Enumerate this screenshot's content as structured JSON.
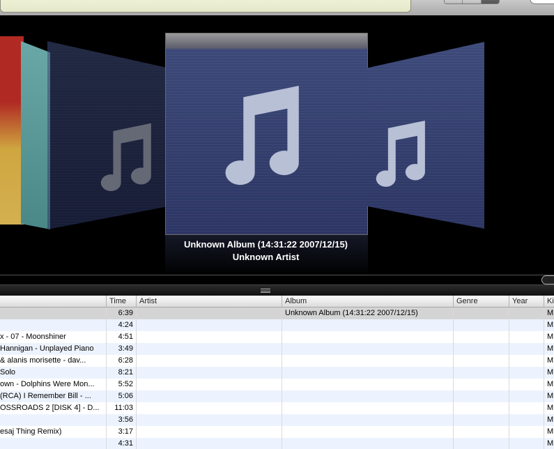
{
  "coverflow": {
    "now_showing": {
      "album": "Unknown Album (14:31:22 2007/12/15)",
      "artist": "Unknown Artist"
    }
  },
  "table": {
    "headers": {
      "time": "Time",
      "artist": "Artist",
      "album": "Album",
      "genre": "Genre",
      "year": "Year",
      "kind": "Ki"
    },
    "rows": [
      {
        "name": "",
        "time": "6:39",
        "artist": "",
        "album": "Unknown Album (14:31:22 2007/12/15)",
        "genre": "",
        "year": "",
        "kind": "M"
      },
      {
        "name": "",
        "time": "4:24",
        "artist": "",
        "album": "",
        "genre": "",
        "year": "",
        "kind": "M"
      },
      {
        "name": "x - 07 - Moonshiner",
        "time": "4:51",
        "artist": "",
        "album": "",
        "genre": "",
        "year": "",
        "kind": "M"
      },
      {
        "name": "Hannigan - Unplayed Piano",
        "time": "3:49",
        "artist": "",
        "album": "",
        "genre": "",
        "year": "",
        "kind": "M"
      },
      {
        "name": "& alanis morisette - dav...",
        "time": "6:28",
        "artist": "",
        "album": "",
        "genre": "",
        "year": "",
        "kind": "M"
      },
      {
        "name": "Solo",
        "time": "8:21",
        "artist": "",
        "album": "",
        "genre": "",
        "year": "",
        "kind": "M"
      },
      {
        "name": "own - Dolphins Were Mon...",
        "time": "5:52",
        "artist": "",
        "album": "",
        "genre": "",
        "year": "",
        "kind": "M"
      },
      {
        "name": "(RCA) I Remember Bill - ...",
        "time": "5:06",
        "artist": "",
        "album": "",
        "genre": "",
        "year": "",
        "kind": "M"
      },
      {
        "name": "OSSROADS 2 [DISK 4] - D...",
        "time": "11:03",
        "artist": "",
        "album": "",
        "genre": "",
        "year": "",
        "kind": "M"
      },
      {
        "name": "",
        "time": "3:56",
        "artist": "",
        "album": "",
        "genre": "",
        "year": "",
        "kind": "M"
      },
      {
        "name": "esaj Thing Remix)",
        "time": "3:17",
        "artist": "",
        "album": "",
        "genre": "",
        "year": "",
        "kind": "M"
      },
      {
        "name": "",
        "time": "4:31",
        "artist": "",
        "album": "",
        "genre": "",
        "year": "",
        "kind": "M"
      }
    ]
  }
}
